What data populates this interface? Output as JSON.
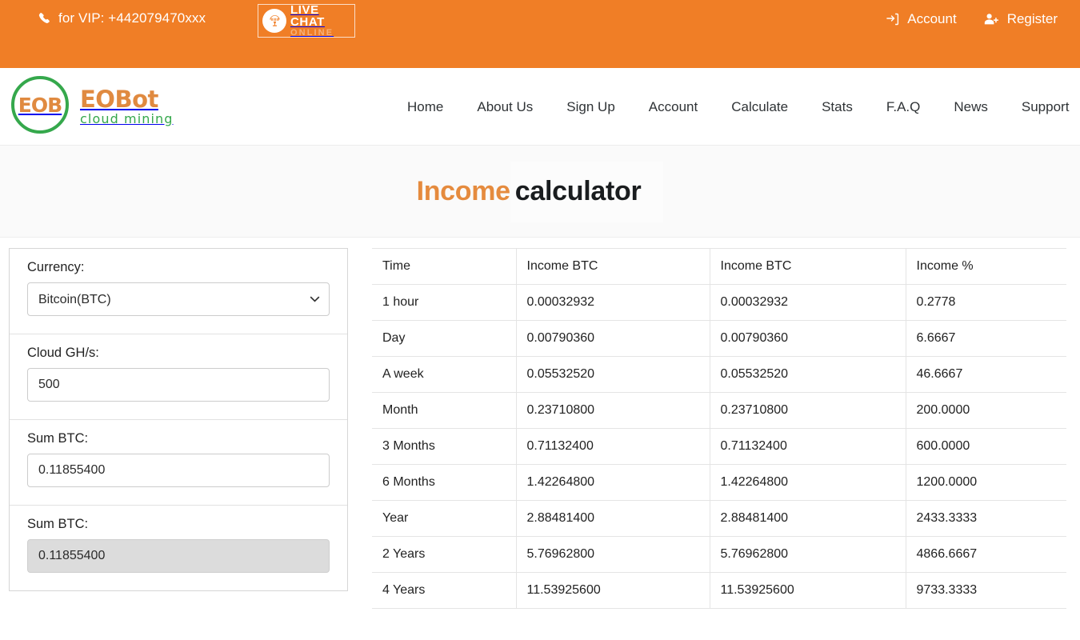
{
  "topbar": {
    "phone_icon": "phone-icon",
    "phone_text": "for VIP: +442079470xxx",
    "livechat": {
      "icon": "headset-icon",
      "line1": "LIVE CHAT",
      "line2": "ONLINE"
    },
    "account_label": "Account",
    "account_icon": "sign-in-icon",
    "register_label": "Register",
    "register_icon": "user-plus-icon",
    "bg_color": "#f07e26"
  },
  "logo": {
    "mark_text": "EOB",
    "word_main": "EOBot",
    "word_sub": "cloud mining",
    "green": "#35a84c",
    "orange": "#e08a40"
  },
  "nav": {
    "items": [
      {
        "label": "Home"
      },
      {
        "label": "About Us"
      },
      {
        "label": "Sign Up"
      },
      {
        "label": "Account"
      },
      {
        "label": "Calculate"
      },
      {
        "label": "Stats"
      },
      {
        "label": "F.A.Q"
      },
      {
        "label": "News"
      },
      {
        "label": "Support"
      }
    ]
  },
  "hero": {
    "title_accent": "Income",
    "title_rest": "calculator",
    "accent_color": "#e58b3e"
  },
  "form": {
    "currency": {
      "label": "Currency:",
      "value": "Bitcoin(BTC)",
      "options": [
        "Bitcoin(BTC)"
      ],
      "chevron_icon": "chevron-down-icon"
    },
    "cloud_ghs": {
      "label": "Cloud GH/s:",
      "value": "500",
      "placeholder": ""
    },
    "sum_btc_input": {
      "label": "Sum BTC:",
      "value": "0.11855400",
      "placeholder": ""
    },
    "sum_btc_readonly": {
      "label": "Sum BTC:",
      "value": "0.11855400",
      "disabled": true
    }
  },
  "chart_data": {
    "type": "table",
    "title": "Income calculator",
    "columns": [
      "Time",
      "Income BTC",
      "Income BTC",
      "Income %"
    ],
    "rows": [
      [
        "1 hour",
        "0.00032932",
        "0.00032932",
        "0.2778"
      ],
      [
        "Day",
        "0.00790360",
        "0.00790360",
        "6.6667"
      ],
      [
        "A week",
        "0.05532520",
        "0.05532520",
        "46.6667"
      ],
      [
        "Month",
        "0.23710800",
        "0.23710800",
        "200.0000"
      ],
      [
        "3 Months",
        "0.71132400",
        "0.71132400",
        "600.0000"
      ],
      [
        "6 Months",
        "1.42264800",
        "1.42264800",
        "1200.0000"
      ],
      [
        "Year",
        "2.88481400",
        "2.88481400",
        "2433.3333"
      ],
      [
        "2 Years",
        "5.76962800",
        "5.76962800",
        "4866.6667"
      ],
      [
        "4 Years",
        "11.53925600",
        "11.53925600",
        "9733.3333"
      ]
    ]
  }
}
